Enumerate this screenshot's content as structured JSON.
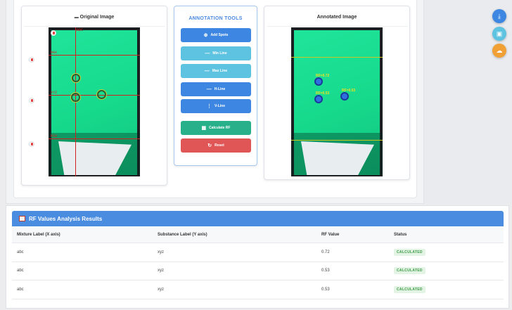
{
  "panels": {
    "original_title": "Original Image",
    "original_icon": "image-icon",
    "annotated_title": "Annotated Image"
  },
  "tools": {
    "title": "ANNOTATION TOOLS",
    "buttons": [
      {
        "label": "Add Spots",
        "icon": "plus-icon"
      },
      {
        "label": "Min Line",
        "icon": "minus-line-icon"
      },
      {
        "label": "Max Line",
        "icon": "max-line-icon"
      },
      {
        "label": "H-Line",
        "icon": "h-line-icon"
      },
      {
        "label": "V-Line",
        "icon": "v-line-icon"
      },
      {
        "label": "Calculate RF",
        "icon": "calculator-icon"
      },
      {
        "label": "Reset",
        "icon": "reset-icon"
      }
    ]
  },
  "image_labels": {
    "top": "BDC",
    "max": "MAX",
    "mid": "XYZ",
    "min": "MIN"
  },
  "annotated_spot_labels": [
    "RF=0.72",
    "RF=0.53",
    "RF=0.53"
  ],
  "fabs": [
    {
      "icon": "download-icon",
      "color": "#3d86e2"
    },
    {
      "icon": "image-icon",
      "color": "#5ec3e0"
    },
    {
      "icon": "cloud-upload-icon",
      "color": "#f0a035"
    }
  ],
  "results": {
    "title": "RF Values Analysis Results",
    "columns": [
      "Mixture Label (X axis)",
      "Substance Label (Y axis)",
      "RF Value",
      "Status"
    ],
    "rows": [
      {
        "mixture": "abc",
        "substance": "xyz",
        "rf": "0.72",
        "status": "CALCULATED"
      },
      {
        "mixture": "abc",
        "substance": "xyz",
        "rf": "0.53",
        "status": "CALCULATED"
      },
      {
        "mixture": "abc",
        "substance": "xyz",
        "rf": "0.53",
        "status": "CALCULATED"
      }
    ]
  }
}
